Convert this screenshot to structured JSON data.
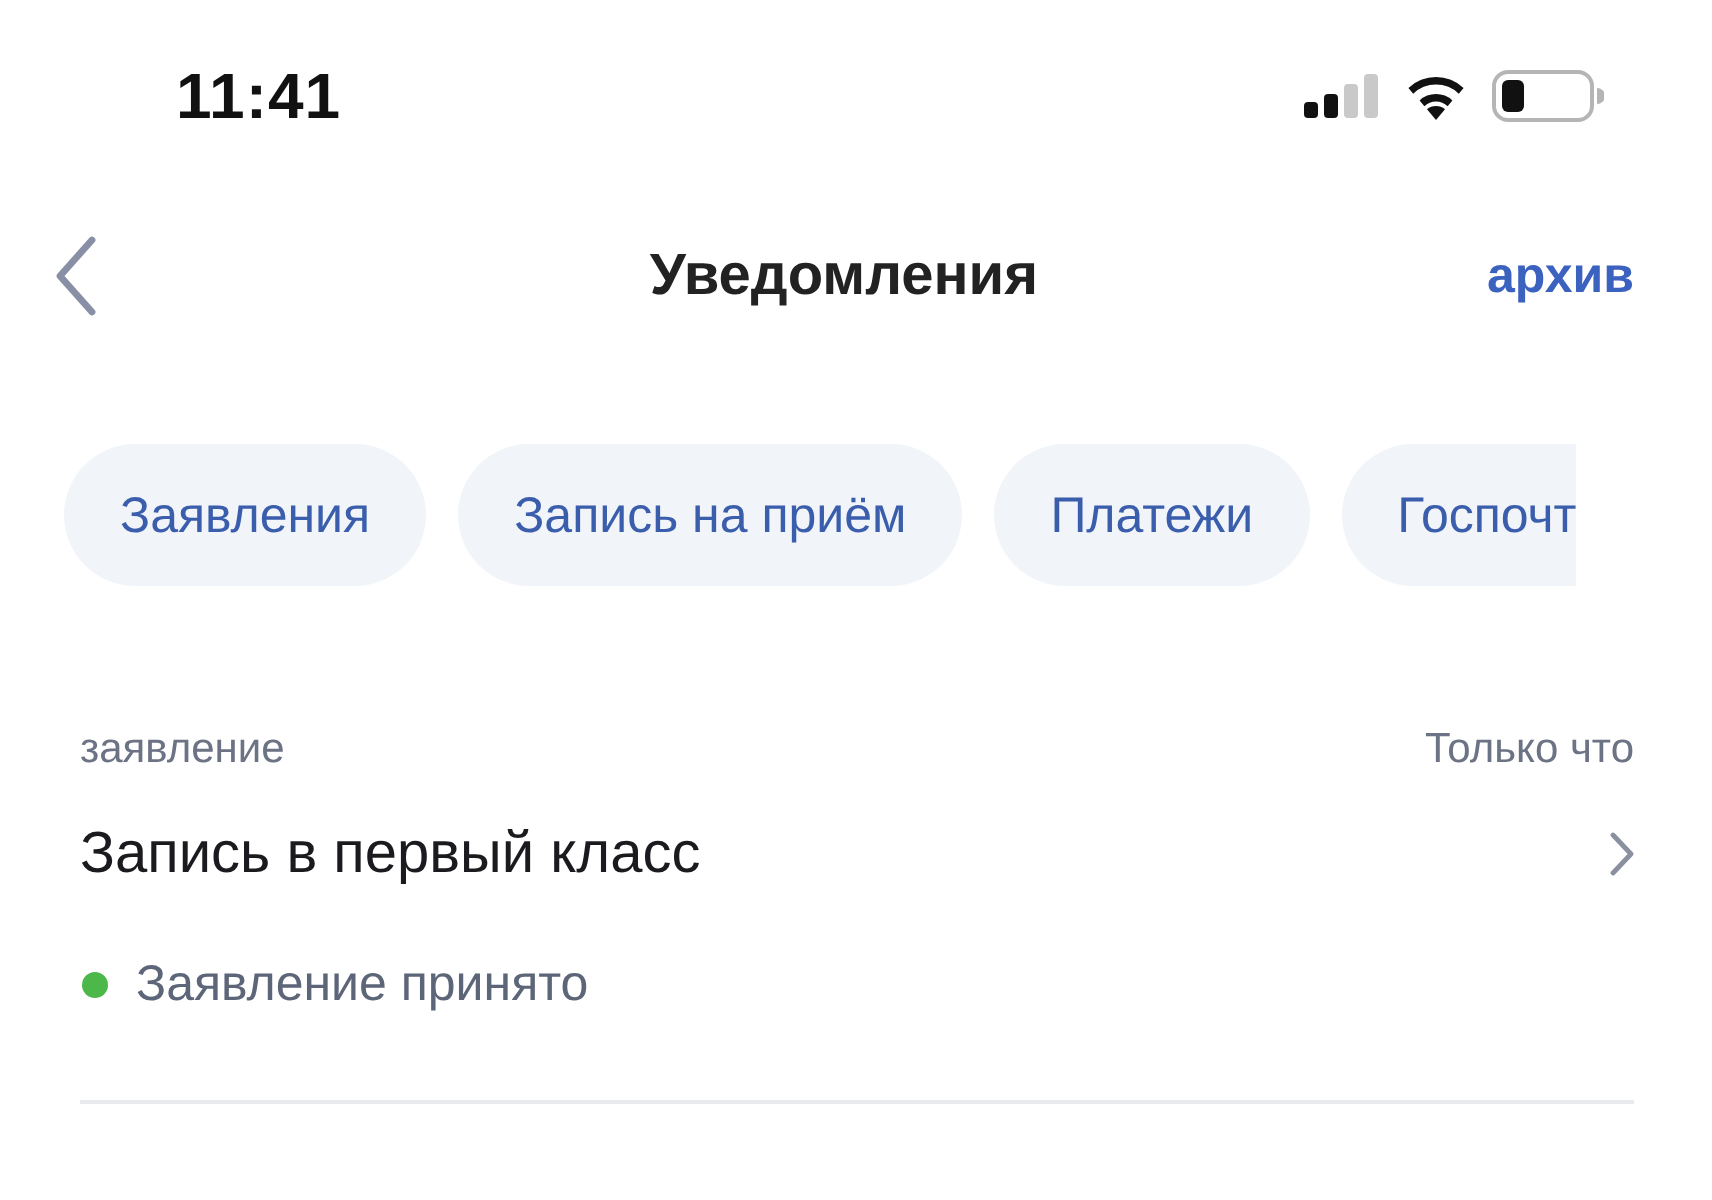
{
  "status_bar": {
    "time": "11:41"
  },
  "nav": {
    "title": "Уведомления",
    "action": "архив"
  },
  "filters": [
    {
      "label": "Заявления",
      "selected": false
    },
    {
      "label": "Запись на приём",
      "selected": false
    },
    {
      "label": "Платежи",
      "selected": false
    },
    {
      "label": "Госпочт",
      "selected": false
    }
  ],
  "notifications": [
    {
      "category": "заявление",
      "time": "Только что",
      "title": "Запись в первый класс",
      "status": {
        "label": "Заявление принято",
        "color": "#4cb84a"
      }
    }
  ]
}
